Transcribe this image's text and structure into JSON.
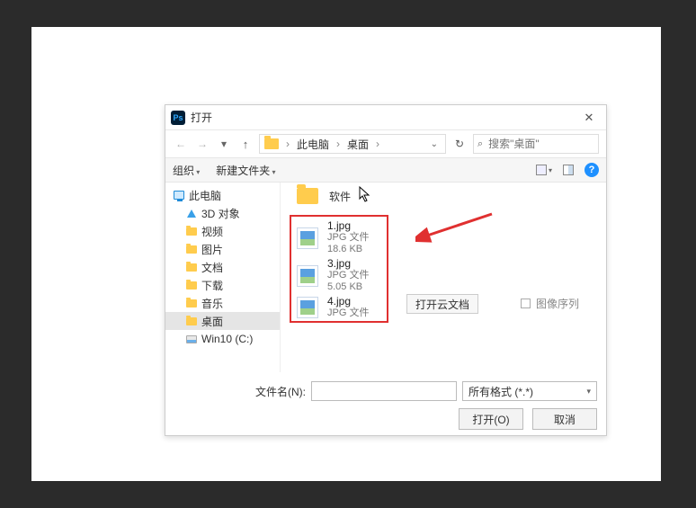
{
  "dialog": {
    "title": "打开",
    "close_glyph": "✕"
  },
  "nav": {
    "up_tooltip": "上一级",
    "breadcrumb": {
      "root": "此电脑",
      "leaf": "桌面"
    },
    "refresh_glyph": "↻",
    "search_placeholder": "搜索\"桌面\""
  },
  "toolbar": {
    "organize": "组织",
    "new_folder": "新建文件夹",
    "help_glyph": "?"
  },
  "tree": {
    "this_pc": "此电脑",
    "items": [
      {
        "label": "3D 对象"
      },
      {
        "label": "视频"
      },
      {
        "label": "图片"
      },
      {
        "label": "文档"
      },
      {
        "label": "下载"
      },
      {
        "label": "音乐"
      },
      {
        "label": "桌面",
        "selected": true
      },
      {
        "label": "Win10 (C:)"
      }
    ]
  },
  "listing": {
    "folder": {
      "name": "软件"
    },
    "files": [
      {
        "name": "1.jpg",
        "type": "JPG 文件",
        "size": "18.6 KB"
      },
      {
        "name": "3.jpg",
        "type": "JPG 文件",
        "size": "5.05 KB"
      },
      {
        "name": "4.jpg",
        "type": "JPG 文件",
        "size": ""
      }
    ]
  },
  "actions": {
    "open_cloud": "打开云文档",
    "image_sequence": "图像序列"
  },
  "footer": {
    "filename_label": "文件名(N):",
    "filter_label": "所有格式 (*.*)",
    "open_btn": "打开(O)",
    "cancel_btn": "取消"
  }
}
